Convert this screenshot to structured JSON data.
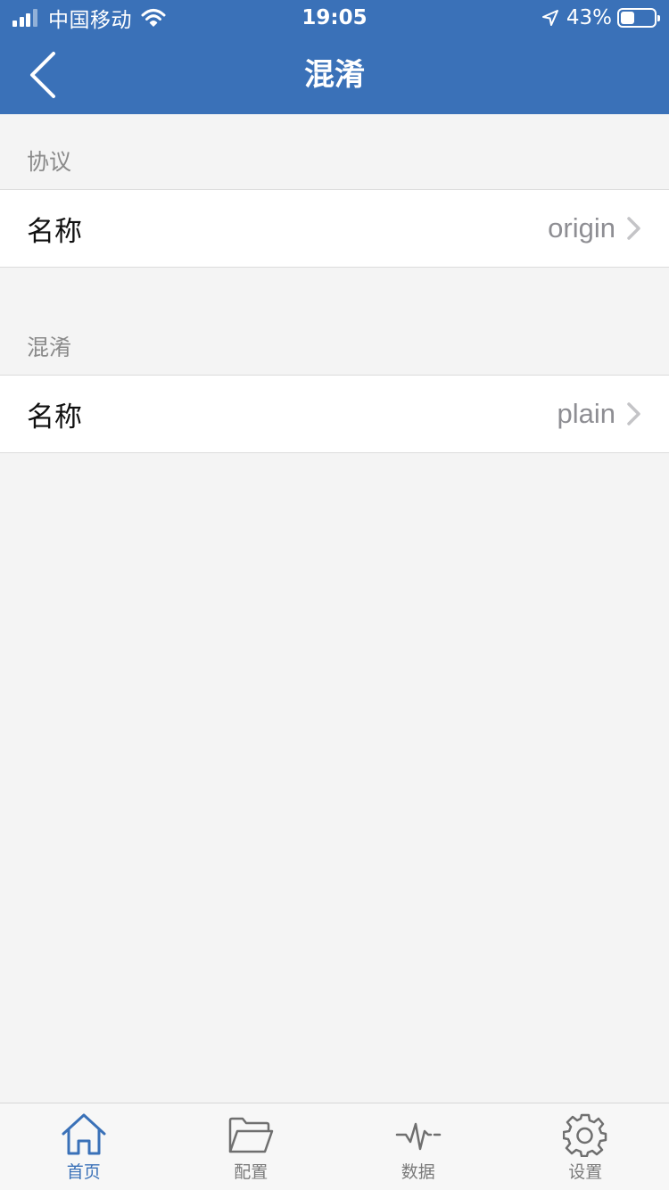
{
  "status_bar": {
    "carrier": "中国移动",
    "time": "19:05",
    "battery_percent": "43%",
    "battery_level": 0.43
  },
  "nav": {
    "title": "混淆",
    "back_icon": "chevron-left-icon"
  },
  "sections": [
    {
      "header": "协议",
      "rows": [
        {
          "label": "名称",
          "value": "origin"
        }
      ]
    },
    {
      "header": "混淆",
      "rows": [
        {
          "label": "名称",
          "value": "plain"
        }
      ]
    }
  ],
  "tabs": [
    {
      "label": "首页",
      "icon": "home-icon",
      "active": true
    },
    {
      "label": "配置",
      "icon": "folder-icon",
      "active": false
    },
    {
      "label": "数据",
      "icon": "pulse-icon",
      "active": false
    },
    {
      "label": "设置",
      "icon": "gear-icon",
      "active": false
    }
  ],
  "colors": {
    "accent": "#3a71b8",
    "background": "#f4f4f4",
    "secondary_text": "#8e8e93"
  }
}
